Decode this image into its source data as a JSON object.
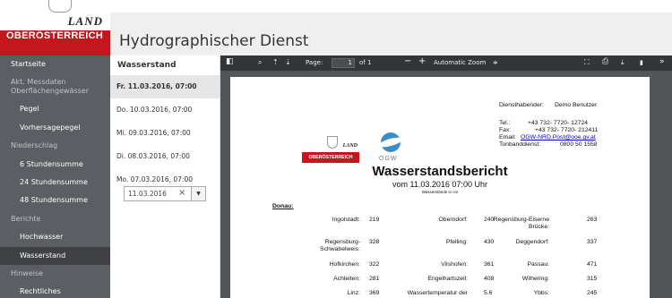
{
  "brand": {
    "land": "LAND",
    "name": "OBERÖSTERREICH"
  },
  "header": {
    "title": "Hydrographischer Dienst"
  },
  "sidebar": {
    "items": [
      {
        "label": "Startseite",
        "type": "top"
      },
      {
        "label": "Akt. Messdaten Oberflächengewässer",
        "type": "group"
      },
      {
        "label": "Pegel",
        "type": "sub"
      },
      {
        "label": "Vorhersagepegel",
        "type": "sub"
      },
      {
        "label": "Niederschlag",
        "type": "group"
      },
      {
        "label": "6 Stundensumme",
        "type": "sub"
      },
      {
        "label": "24 Stundensumme",
        "type": "sub"
      },
      {
        "label": "48 Stundensumme",
        "type": "sub"
      },
      {
        "label": "Berichte",
        "type": "group"
      },
      {
        "label": "Hochwasser",
        "type": "sub"
      },
      {
        "label": "Wasserstand",
        "type": "sub",
        "active": true
      },
      {
        "label": "Hinweise",
        "type": "group"
      },
      {
        "label": "Rechtliches",
        "type": "sub"
      }
    ]
  },
  "reports": {
    "heading": "Wasserstand",
    "dates": [
      "Fr. 11.03.2016, 07:00",
      "Do. 10.03.2016, 07:00",
      "Mi. 09.03.2016, 07:00",
      "Di. 08.03.2016, 07:00",
      "Mo. 07.03.2016, 07:00"
    ],
    "selected_index": 0,
    "date_input_value": "11.03.2016",
    "clear_glyph": "×",
    "dropdown_glyph": "▼"
  },
  "pdf_toolbar": {
    "sidebar_toggle": "◧",
    "search": "⌕",
    "prev": "⇡",
    "next": "⇣",
    "page_label": "Page:",
    "page_value": "1",
    "page_of": "of 1",
    "zoom_out": "−",
    "zoom_in": "+",
    "zoom_value": "Automatic Zoom",
    "zoom_caret": "≑",
    "present": "⛶",
    "print": "⎙",
    "download": "⤓",
    "bookmark": "▮",
    "more": "»"
  },
  "report": {
    "logo_land": "LAND",
    "logo_name": "OBERÖSTERREICH",
    "ogw": "OGW",
    "contact": {
      "duty_label": "Diensthabender:",
      "duty_value": "Demo Benutzer",
      "tel_label": "Tel.:",
      "tel_value": "+43 732- 7720- 12724",
      "fax_label": "Fax:",
      "fax_value": "+43 732- 7720- 212411",
      "email_label": "Email:",
      "email_value": "OGW-NRD.Post@ooe.gv.at",
      "tape_label": "Tonbanddienst:",
      "tape_value": "0800 50 1558"
    },
    "title": "Wasserstandsbericht",
    "subtitle": "vom 11.03.2016 07:00 Uhr",
    "unit_note": "Wasserstände in cm",
    "river": "Donau:",
    "rows": [
      [
        {
          "name": "Ingolstadt:",
          "value": "219"
        },
        {
          "name": "Oberndorf:",
          "value": "240"
        },
        {
          "name": "Regensburg-Eiserne Brücke:",
          "value": "263"
        }
      ],
      [
        {
          "name": "Regensburg-Schwabelweis:",
          "value": "328"
        },
        {
          "name": "Pfelling:",
          "value": "430"
        },
        {
          "name": "Deggendorf:",
          "value": "337"
        }
      ],
      [
        {
          "name": "Hofkirchen:",
          "value": "322"
        },
        {
          "name": "Vilshofen:",
          "value": "361"
        },
        {
          "name": "Passau:",
          "value": "471"
        }
      ],
      [
        {
          "name": "Achleiten:",
          "value": "281"
        },
        {
          "name": "Engelhartszell:",
          "value": "408"
        },
        {
          "name": "Wilhering:",
          "value": "315"
        }
      ],
      [
        {
          "name": "Linz:",
          "value": "369"
        },
        {
          "name": "Wassertemperatur der",
          "value": "5.6"
        },
        {
          "name": "Ybbs:",
          "value": "245"
        }
      ]
    ]
  }
}
